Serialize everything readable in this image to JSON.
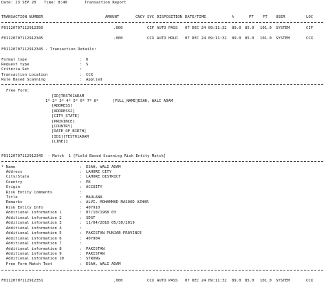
{
  "header": {
    "date": "Date: 23 SEP 20",
    "time": "Time: 8:40",
    "title": "Transaction Report"
  },
  "columns": [
    "TRANSACTION NUMBER",
    "AMOUNT",
    "CNCY",
    "SVC",
    "DISPOSITION",
    "DATE/TIME",
    "%",
    "PT",
    "FT",
    "USER",
    "LOC"
  ],
  "rows": [
    {
      "txn": "F01120707112912350",
      "amount": ".000",
      "cncy": "",
      "svc": "CIF",
      "disp": "AUTO PASS",
      "dt": "07 DEC 24 09:11:32",
      "pct": "89.0",
      "pt": "85.0",
      "ft": "101.0",
      "user": "SYSTEM",
      "loc": "CIF"
    },
    {
      "txn": "F01120707112912345",
      "amount": ".000",
      "cncy": "",
      "svc": "CCX",
      "disp": "AUTO HOLD",
      "dt": "07 DEC 24 09:11:32",
      "pct": "89.0",
      "pt": "85.0",
      "ft": "101.0",
      "user": "SYSTEM",
      "loc": "CCX"
    }
  ],
  "details": {
    "heading": "F01120707112912345 - Transaction Details:",
    "fields": [
      {
        "label": "Format type",
        "value": "U"
      },
      {
        "label": "Request type",
        "value": "S"
      },
      {
        "label": "Criteria Set",
        "value": ""
      },
      {
        "label": "Transaction Location",
        "value": "CCX"
      },
      {
        "label": "Rule Based Scanning",
        "value": "Applied"
      }
    ]
  },
  "freeform": {
    "label": "Free Form:",
    "lines": [
      "[ID]TEST01ADAM",
      "1* 2* 3* 4* 5* 6* 7* 8*      [FULL_NAME]ESAH, WALI ADAM",
      "[ADDRESS]",
      "[ADDRESS2]",
      "[CITY_STATE]",
      "[PROVINCE]",
      "[COUNTRY]",
      "[DATE_OF_BIRTH]",
      "[ID1][TEST01ADAM",
      "[LINE]1"
    ]
  },
  "match": {
    "heading": "F01120707112912345  - Match  1 [Field Based Scanning Risk Entity Match]",
    "fields": [
      {
        "label": "* Name",
        "value": "ESAH, WALI ADAM"
      },
      {
        "label": "  Address",
        "value": "LAHORE CITY"
      },
      {
        "label": "  City/State",
        "value": "LAHORE DISTRICT"
      },
      {
        "label": "  Country",
        "value": "PK"
      },
      {
        "label": "  Origin",
        "value": "ACCUITY"
      },
      {
        "label": "  Risk Entity Comments",
        "value": ""
      },
      {
        "label": "  Title",
        "value": "MAULANA"
      },
      {
        "label": "  Remarks",
        "value": "ALVI, MOHAMMAD MASOOD AZHAR"
      },
      {
        "label": "  Risk Entity Info",
        "value": "407910"
      },
      {
        "label": "  Additional information 1",
        "value": "07/10/1968 03"
      },
      {
        "label": "  Additional information 2",
        "value": "SDGT"
      },
      {
        "label": "  Additional information 3",
        "value": "11/04/2010 05/30/2019"
      },
      {
        "label": "  Additional information 4",
        "value": ""
      },
      {
        "label": "  Additional information 5",
        "value": "PAKISTAN PUNJAB PROVINCE"
      },
      {
        "label": "  Additional information 6",
        "value": "407904"
      },
      {
        "label": "  Additional information 7",
        "value": ""
      },
      {
        "label": "  Additional information 8",
        "value": "PAKISTAN"
      },
      {
        "label": "  Additional information 9",
        "value": "PAKISTAN"
      },
      {
        "label": "  Additional information 10",
        "value": "STRONG"
      },
      {
        "label": "  Free Form Match Text",
        "value": "ESAH, WALI ADAM"
      }
    ]
  },
  "footer_row": {
    "txn": "F01120707112912351",
    "amount": ".000",
    "cncy": "",
    "svc": "CCX",
    "disp": "AUTO PASS",
    "dt": "07 DEC 24 09:11:32",
    "pct": "89.0",
    "pt": "85.0",
    "ft": "101.0",
    "user": "SYSTEM",
    "loc": "CCX"
  }
}
